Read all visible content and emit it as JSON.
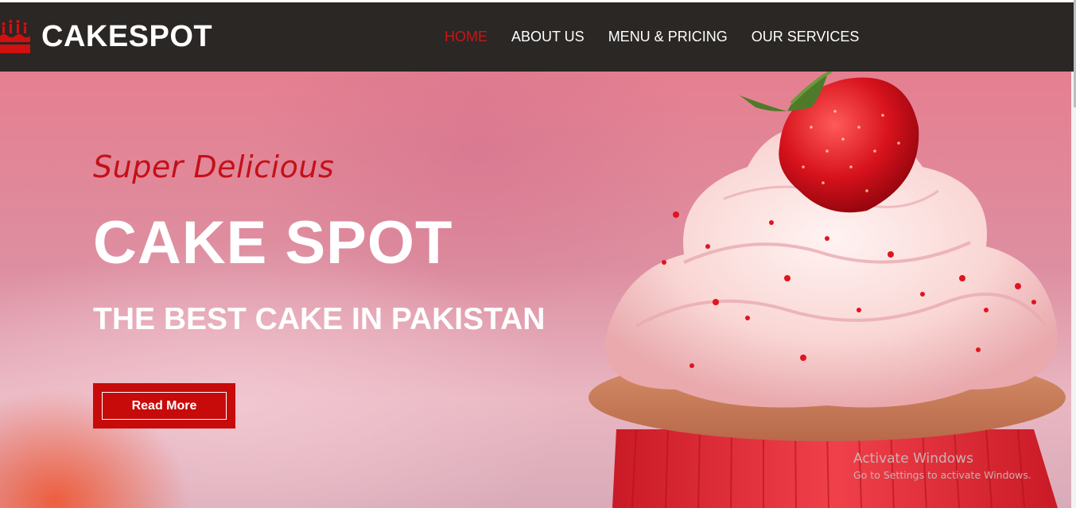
{
  "brand": {
    "name": "CAKESPOT",
    "icon": "cake-icon",
    "accent_color": "#cc1414"
  },
  "nav": {
    "items": [
      {
        "label": "HOME",
        "active": true
      },
      {
        "label": "ABOUT US",
        "active": false
      },
      {
        "label": "MENU & PRICING",
        "active": false
      },
      {
        "label": "OUR SERVICES",
        "active": false
      }
    ]
  },
  "hero": {
    "tagline": "Super Delicious",
    "headline": "CAKE SPOT",
    "subheadline": "THE BEST CAKE IN PAKISTAN",
    "cta_label": "Read More",
    "image": "strawberry-cupcake-image"
  },
  "watermark": {
    "title": "Activate Windows",
    "subtitle": "Go to Settings to activate Windows."
  }
}
